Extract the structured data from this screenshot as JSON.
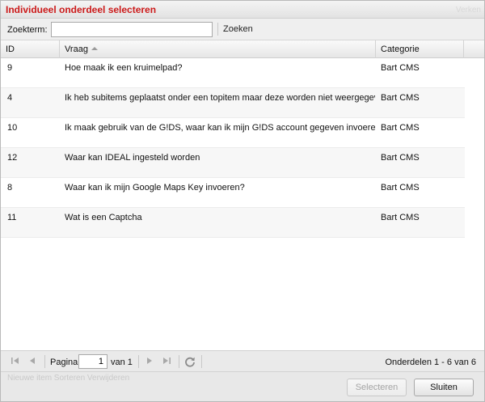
{
  "dialog": {
    "title": "Individueel onderdeel selecteren",
    "ghost_title": "Verken",
    "accent_color": "#cc1a1a"
  },
  "search": {
    "label": "Zoekterm:",
    "value": "",
    "button_label": "Zoeken"
  },
  "grid": {
    "columns": [
      {
        "key": "id",
        "label": "ID"
      },
      {
        "key": "vraag",
        "label": "Vraag",
        "sorted": "asc"
      },
      {
        "key": "categorie",
        "label": "Categorie"
      }
    ],
    "rows": [
      {
        "id": "9",
        "vraag": "Hoe maak ik een kruimelpad?",
        "categorie": "Bart CMS"
      },
      {
        "id": "4",
        "vraag": "Ik heb subitems geplaatst onder een topitem maar deze worden niet weergegev",
        "categorie": "Bart CMS"
      },
      {
        "id": "10",
        "vraag": "Ik maak gebruik van de G!DS, waar kan ik mijn G!DS account gegeven invoeren?",
        "categorie": "Bart CMS"
      },
      {
        "id": "12",
        "vraag": "Waar kan IDEAL ingesteld worden",
        "categorie": "Bart CMS"
      },
      {
        "id": "8",
        "vraag": "Waar kan ik mijn Google Maps Key invoeren?",
        "categorie": "Bart CMS"
      },
      {
        "id": "11",
        "vraag": "Wat is een Captcha",
        "categorie": "Bart CMS"
      }
    ]
  },
  "pager": {
    "page_label": "Pagina",
    "page_value": "1",
    "of_label": "van 1",
    "info": "Onderdelen 1 - 6 van 6",
    "icons": [
      "first-page-icon",
      "prev-page-icon",
      "next-page-icon",
      "last-page-icon",
      "refresh-icon"
    ]
  },
  "footer": {
    "ghost_text": "Nieuwe item   Sorteren   Verwijderen",
    "select_label": "Selecteren",
    "close_label": "Sluiten"
  }
}
